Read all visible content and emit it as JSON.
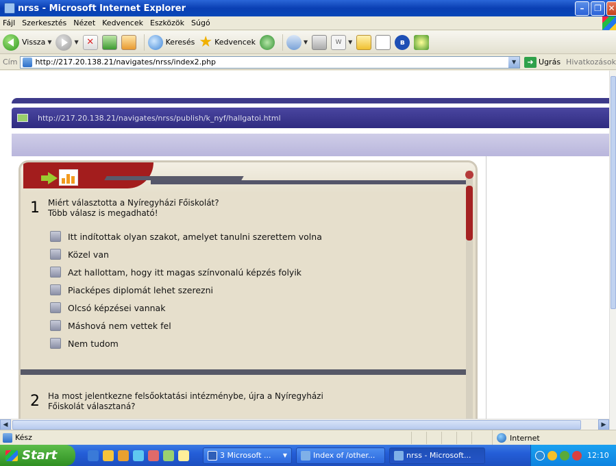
{
  "window": {
    "title": "nrss - Microsoft Internet Explorer"
  },
  "menu": {
    "items": [
      "Fájl",
      "Szerkesztés",
      "Nézet",
      "Kedvencek",
      "Eszközök",
      "Súgó"
    ]
  },
  "toolbar": {
    "back_label": "Vissza",
    "search_label": "Keresés",
    "favorites_label": "Kedvencek"
  },
  "address": {
    "label": "Cím",
    "url": "http://217.20.138.21/navigates/nrss/index2.php",
    "go_label": "Ugrás",
    "links_label": "Hivatkozások"
  },
  "frame": {
    "url": "http://217.20.138.21/navigates/nrss/publish/k_nyf/hallgatoi.html"
  },
  "survey": {
    "q1": {
      "number": "1",
      "text_line1": "Miért választotta a Nyíregyházi Főiskolát?",
      "text_line2": "Több válasz is megadható!",
      "options": [
        "Itt indítottak olyan szakot, amelyet tanulni szerettem volna",
        "Közel van",
        "Azt hallottam, hogy itt magas színvonalú képzés folyik",
        "Piacképes diplomát lehet szerezni",
        "Olcsó képzései vannak",
        "Máshová nem vettek fel",
        "Nem tudom"
      ]
    },
    "q2": {
      "number": "2",
      "text_line1": "Ha most jelentkezne felsőoktatási intézménybe, újra a Nyíregyházi",
      "text_line2": "Főiskolát választaná?"
    }
  },
  "status": {
    "text": "Kész",
    "zone": "Internet"
  },
  "taskbar": {
    "start_label": "Start",
    "tasks": [
      "3 Microsoft ...",
      "Index of /other...",
      "nrss - Microsoft..."
    ],
    "clock": "12:10"
  }
}
